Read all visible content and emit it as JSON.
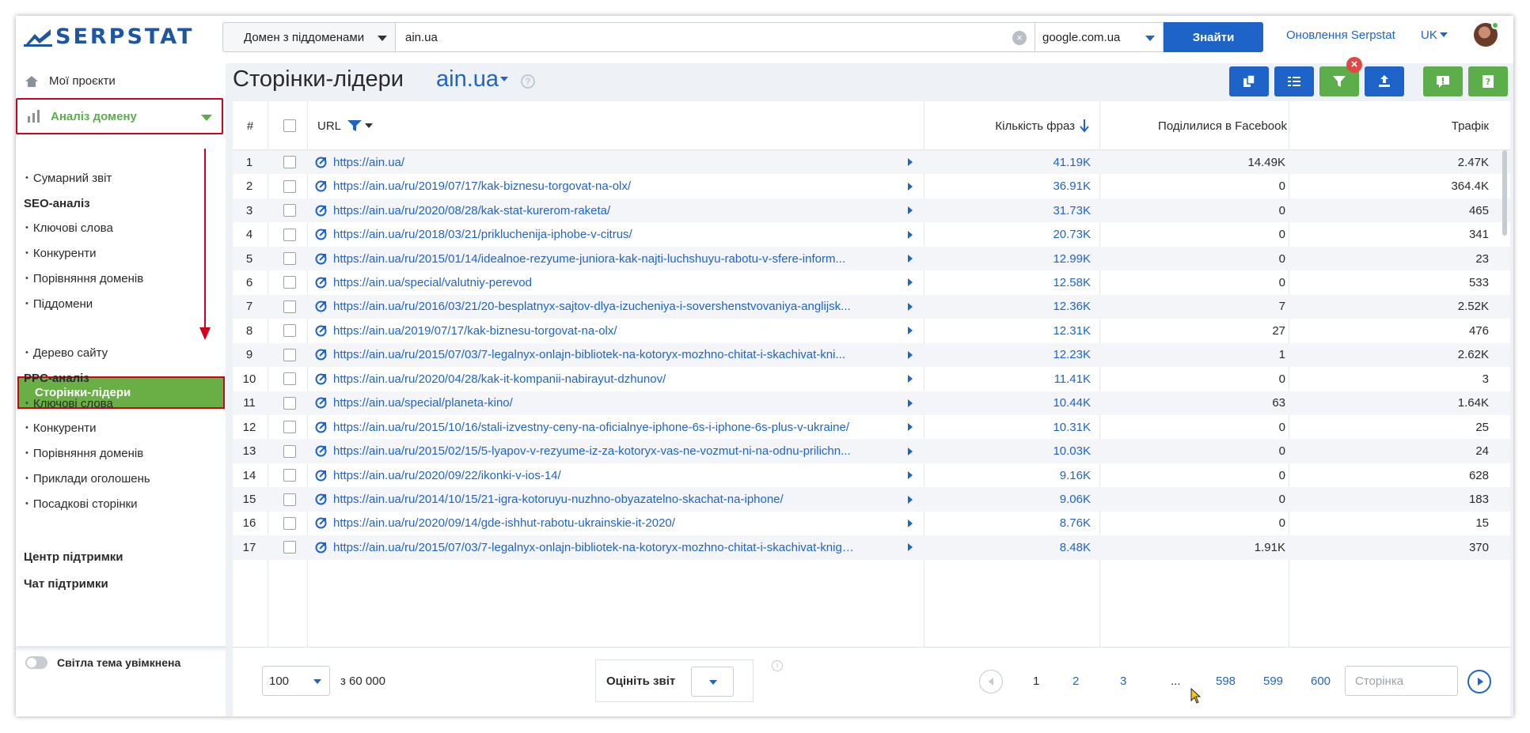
{
  "brand": {
    "name": "SERPSTAT",
    "accent": "#1e64c8",
    "green": "#6aae46",
    "highlight": "#d0021b"
  },
  "search": {
    "scope": "Домен з піддоменами",
    "domain": "ain.ua",
    "engine": "google.com.ua",
    "find_label": "Знайти"
  },
  "header": {
    "update_link": "Оновлення Serpstat",
    "language": "UK"
  },
  "sidebar": {
    "projects": "Мої проєкти",
    "domain_analysis": "Аналіз домену",
    "summary": "Сумарний звіт",
    "seo_head": "SEO-аналіз",
    "seo_items": [
      "Ключові слова",
      "Конкуренти",
      "Порівняння доменів",
      "Піддомени"
    ],
    "active": "Сторінки-лідери",
    "site_tree": "Дерево сайту",
    "ppc_head": "PPC-аналіз",
    "ppc_items": [
      "Ключові слова",
      "Конкуренти",
      "Порівняння доменів",
      "Приклади оголошень",
      "Посадкові сторінки"
    ],
    "support_center": "Центр підтримки",
    "support_chat": "Чат підтримки",
    "theme_toggle": "Світла тема увімкнена"
  },
  "page": {
    "title": "Сторінки-лідери",
    "domain": "ain.ua"
  },
  "table": {
    "columns": {
      "num": "#",
      "url": "URL",
      "phrases": "Кількість фраз",
      "facebook": "Поділилися в Facebook",
      "traffic": "Трафік"
    },
    "rows": [
      {
        "n": "1",
        "url": "https://ain.ua/",
        "phrases": "41.19K",
        "fb": "14.49K",
        "traffic": "2.47K"
      },
      {
        "n": "2",
        "url": "https://ain.ua/ru/2019/07/17/kak-biznesu-torgovat-na-olx/",
        "phrases": "36.91K",
        "fb": "0",
        "traffic": "364.4K"
      },
      {
        "n": "3",
        "url": "https://ain.ua/ru/2020/08/28/kak-stat-kurerom-raketa/",
        "phrases": "31.73K",
        "fb": "0",
        "traffic": "465"
      },
      {
        "n": "4",
        "url": "https://ain.ua/ru/2018/03/21/prikluchenija-iphobe-v-citrus/",
        "phrases": "20.73K",
        "fb": "0",
        "traffic": "341"
      },
      {
        "n": "5",
        "url": "https://ain.ua/ru/2015/01/14/idealnoe-rezyume-juniora-kak-najti-luchshuyu-rabotu-v-sfere-inform...",
        "phrases": "12.99K",
        "fb": "0",
        "traffic": "23"
      },
      {
        "n": "6",
        "url": "https://ain.ua/special/valutniy-perevod",
        "phrases": "12.58K",
        "fb": "0",
        "traffic": "533"
      },
      {
        "n": "7",
        "url": "https://ain.ua/ru/2016/03/21/20-besplatnyx-sajtov-dlya-izucheniya-i-sovershenstvovaniya-anglijsk...",
        "phrases": "12.36K",
        "fb": "7",
        "traffic": "2.52K"
      },
      {
        "n": "8",
        "url": "https://ain.ua/2019/07/17/kak-biznesu-torgovat-na-olx/",
        "phrases": "12.31K",
        "fb": "27",
        "traffic": "476"
      },
      {
        "n": "9",
        "url": "https://ain.ua/ru/2015/07/03/7-legalnyx-onlajn-bibliotek-na-kotoryx-mozhno-chitat-i-skachivat-kni...",
        "phrases": "12.23K",
        "fb": "1",
        "traffic": "2.62K"
      },
      {
        "n": "10",
        "url": "https://ain.ua/ru/2020/04/28/kak-it-kompanii-nabirayut-dzhunov/",
        "phrases": "11.41K",
        "fb": "0",
        "traffic": "3"
      },
      {
        "n": "11",
        "url": "https://ain.ua/special/planeta-kino/",
        "phrases": "10.44K",
        "fb": "63",
        "traffic": "1.64K"
      },
      {
        "n": "12",
        "url": "https://ain.ua/ru/2015/10/16/stali-izvestny-ceny-na-oficialnye-iphone-6s-i-iphone-6s-plus-v-ukraine/",
        "phrases": "10.31K",
        "fb": "0",
        "traffic": "25"
      },
      {
        "n": "13",
        "url": "https://ain.ua/ru/2015/02/15/5-lyapov-v-rezyume-iz-za-kotoryx-vas-ne-vozmut-ni-na-odnu-prilichn...",
        "phrases": "10.03K",
        "fb": "0",
        "traffic": "24"
      },
      {
        "n": "14",
        "url": "https://ain.ua/ru/2020/09/22/ikonki-v-ios-14/",
        "phrases": "9.16K",
        "fb": "0",
        "traffic": "628"
      },
      {
        "n": "15",
        "url": "https://ain.ua/ru/2014/10/15/21-igra-kotoruyu-nuzhno-obyazatelno-skachat-na-iphone/",
        "phrases": "9.06K",
        "fb": "0",
        "traffic": "183"
      },
      {
        "n": "16",
        "url": "https://ain.ua/ru/2020/09/14/gde-ishhut-rabotu-ukrainskie-it-2020/",
        "phrases": "8.76K",
        "fb": "0",
        "traffic": "15"
      },
      {
        "n": "17",
        "url": "https://ain.ua/ru/2015/07/03/7-legalnyx-onlajn-bibliotek-na-kotoryx-mozhno-chitat-i-skachivat-knigi-...",
        "phrases": "8.48K",
        "fb": "1.91K",
        "traffic": "370"
      }
    ]
  },
  "footer": {
    "per_page": "100",
    "of_total": "з 60 000",
    "rate_label": "Оцініть звіт",
    "pages": [
      "1",
      "2",
      "3",
      "...",
      "598",
      "599",
      "600"
    ],
    "page_input_placeholder": "Сторінка"
  }
}
